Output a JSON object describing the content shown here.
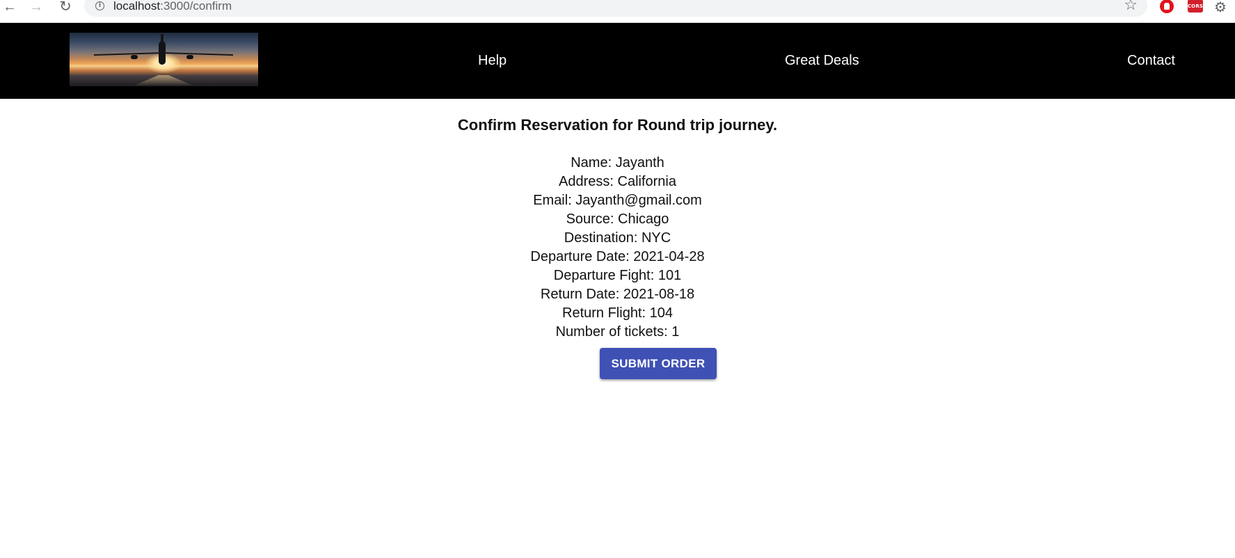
{
  "browser": {
    "url_host": "localhost",
    "url_rest": ":3000/confirm",
    "icons": {
      "back": "arrow-left-icon",
      "forward": "arrow-right-icon",
      "reload": "reload-icon",
      "info": "info-icon",
      "bookmark": "star-icon",
      "ext1": "block-extension-icon",
      "ext2": "cors-extension-icon",
      "ext3": "puzzle-extension-icon"
    },
    "cors_label": "CORS"
  },
  "header": {
    "nav": {
      "help": "Help",
      "deals": "Great Deals",
      "contact": "Contact"
    },
    "background": "#000000"
  },
  "main": {
    "title": "Confirm Reservation for Round trip journey.",
    "details": [
      "Name: Jayanth",
      "Address: California",
      "Email: Jayanth@gmail.com",
      "Source: Chicago",
      "Destination: NYC",
      "Departure Date: 2021-04-28",
      "Departure Fight: 101",
      "Return Date: 2021-08-18",
      "Return Flight: 104",
      "Number of tickets: 1"
    ],
    "submit_label": "SUBMIT ORDER",
    "accent": "#3f51b5"
  }
}
